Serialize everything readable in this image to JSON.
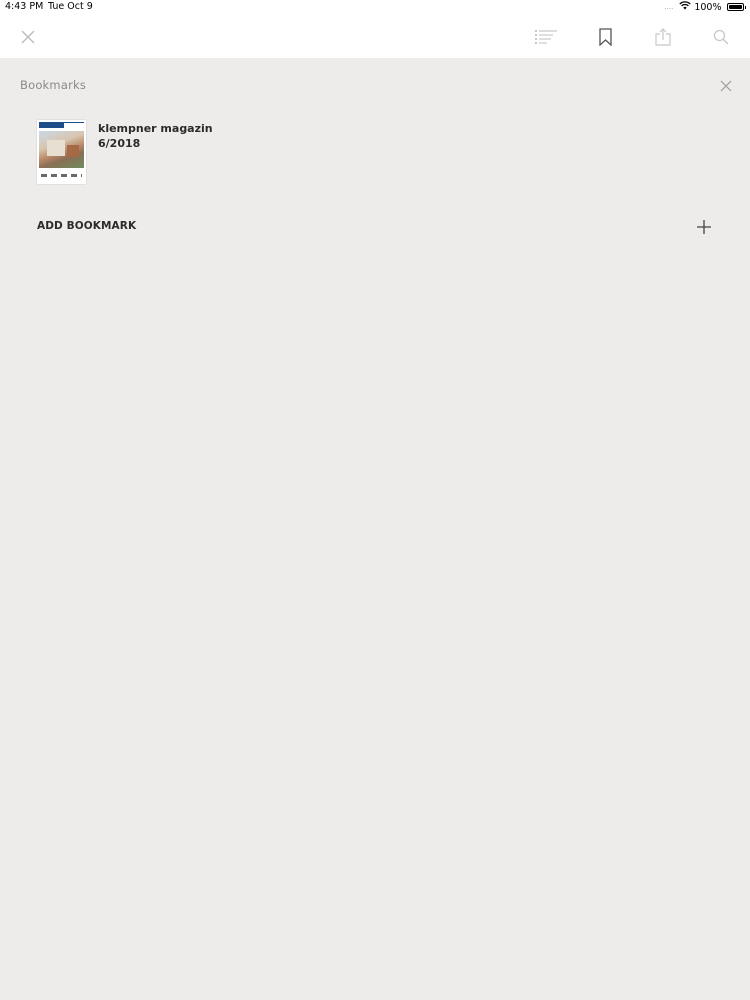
{
  "status_bar": {
    "time": "4:43 PM",
    "date": "Tue Oct 9",
    "signal": "....",
    "battery": "100%"
  },
  "toolbar": {
    "icons": [
      "close-icon",
      "table-of-contents-icon",
      "bookmark-icon",
      "share-icon",
      "search-icon"
    ]
  },
  "panel": {
    "title": "Bookmarks",
    "bookmarks": [
      {
        "title": "klempner magazin",
        "issue": "6/2018",
        "thumbnail_masthead": "klempner magazin"
      }
    ],
    "add_label": "ADD BOOKMARK"
  },
  "colors": {
    "background": "#edecea",
    "toolbar": "#ffffff",
    "text": "#2b2b2b",
    "muted": "#8a8a8a"
  }
}
